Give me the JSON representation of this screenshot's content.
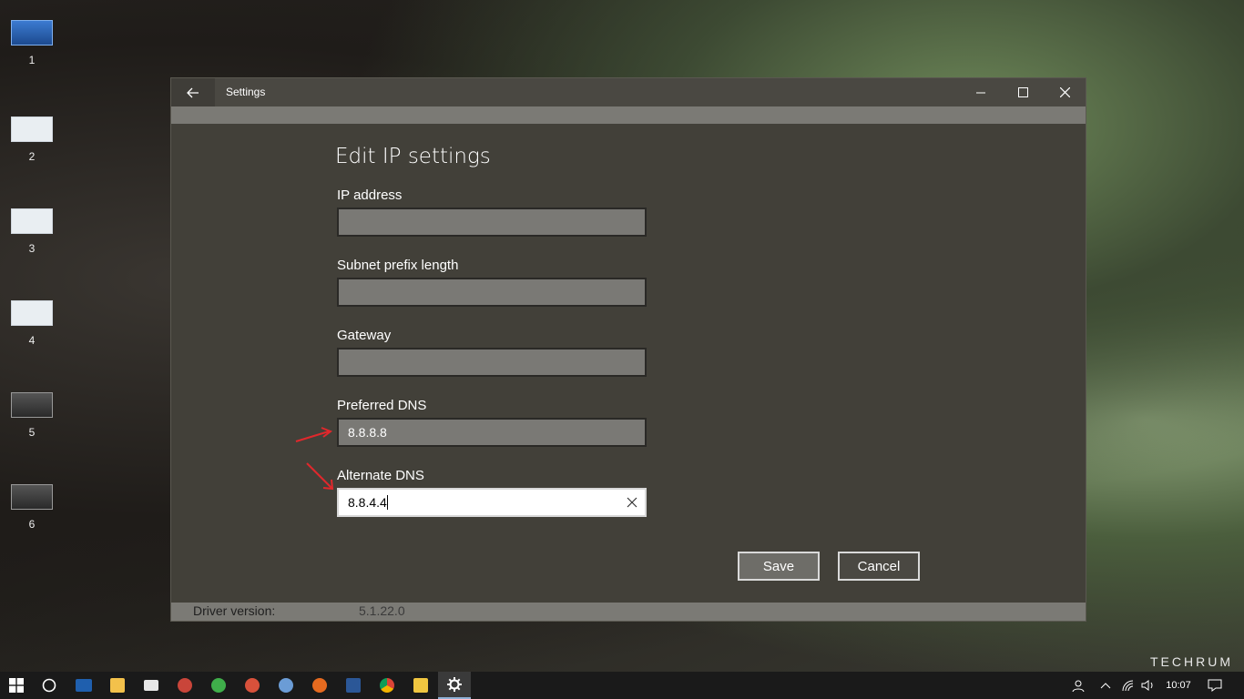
{
  "desktops": [
    "1",
    "2",
    "3",
    "4",
    "5",
    "6"
  ],
  "window": {
    "title": "Settings",
    "dialog_title": "Edit IP settings",
    "fields": [
      {
        "label": "IP address",
        "value": ""
      },
      {
        "label": "Subnet prefix length",
        "value": ""
      },
      {
        "label": "Gateway",
        "value": ""
      },
      {
        "label": "Preferred DNS",
        "value": "8.8.8.8"
      },
      {
        "label": "Alternate DNS",
        "value": "8.8.4.4"
      }
    ],
    "save_label": "Save",
    "cancel_label": "Cancel",
    "footer": {
      "key": "Driver version:",
      "value": "5.1.22.0"
    }
  },
  "watermark": "TECHRUM",
  "taskbar": {
    "clock": "10:07",
    "apps": [
      "file-explorer",
      "mail",
      "app-red",
      "app-green",
      "app-swirl",
      "app-pal",
      "firefox",
      "word",
      "chrome",
      "media",
      "settings"
    ]
  },
  "colors": {
    "accent": "#8fb1d6",
    "window_bg": "#424039",
    "arrow": "#e0282c"
  }
}
